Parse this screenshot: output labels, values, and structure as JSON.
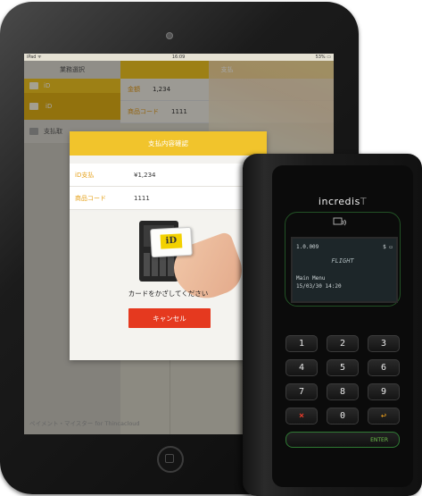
{
  "status_bar": {
    "carrier": "iPad ᯤ",
    "time": "16:09",
    "battery": "53% ▭"
  },
  "sidebar": {
    "header": "業務選択",
    "items": [
      {
        "label": "iD",
        "icon": "id-icon"
      },
      {
        "label": "iD",
        "icon": "card-icon"
      },
      {
        "label": "支払取",
        "icon": "envelope-icon"
      }
    ]
  },
  "detail": {
    "header": "支払",
    "rows": [
      {
        "key": "金額",
        "value": "1,234"
      },
      {
        "key": "商品コード",
        "value": "1111"
      }
    ]
  },
  "app_footer": "ペイメント・マイスター for Thincacloud",
  "modal": {
    "title": "支払内容確認",
    "rows": [
      {
        "key": "iD支払",
        "value": "¥1,234"
      },
      {
        "key": "商品コード",
        "value": "1111"
      }
    ],
    "card_badge": "iD",
    "instruction": "カードをかざしてください",
    "cancel_label": "キャンセル"
  },
  "terminal": {
    "brand_main": "incredis",
    "brand_tail": "T",
    "lcd": {
      "version": "1.0.009",
      "indicator": "$ ▭",
      "logo": "FLIGHT",
      "menu": "Main Menu",
      "datetime": "15/03/30 14:20"
    },
    "keys": [
      "1",
      "2",
      "3",
      "4",
      "5",
      "6",
      "7",
      "8",
      "9",
      "×",
      "0",
      "↩"
    ],
    "enter_label": "ENTER",
    "colors": {
      "frame_green": "#2f7a34",
      "cancel_red": "#e53b2a",
      "back_orange": "#f0a11c"
    }
  },
  "colors": {
    "accent_yellow": "#f2c521",
    "cancel_button": "#e5391f"
  }
}
